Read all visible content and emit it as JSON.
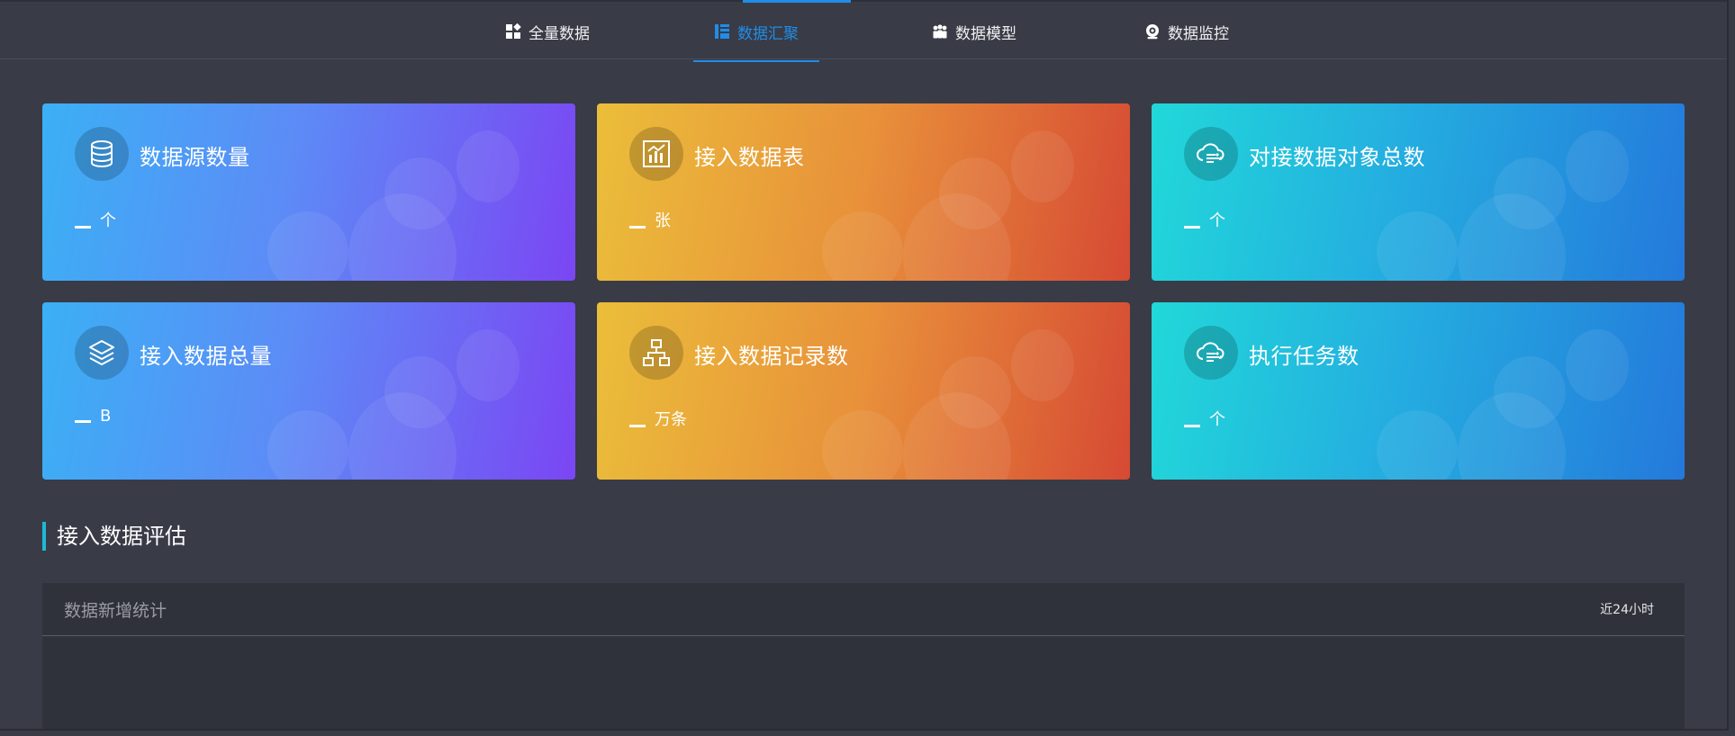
{
  "nav": {
    "items": [
      {
        "label": "全量数据",
        "icon": "grid-icon"
      },
      {
        "label": "数据汇聚",
        "icon": "layout-icon",
        "active": true
      },
      {
        "label": "数据模型",
        "icon": "people-icon"
      },
      {
        "label": "数据监控",
        "icon": "webcam-icon"
      }
    ]
  },
  "cards": [
    {
      "title": "数据源数量",
      "value": "_",
      "unit": "个",
      "icon": "database-icon",
      "theme": "blue-purple"
    },
    {
      "title": "接入数据表",
      "value": "_",
      "unit": "张",
      "icon": "chart-icon",
      "theme": "yellow-red"
    },
    {
      "title": "对接数据对象总数",
      "value": "_",
      "unit": "个",
      "icon": "cloud-flow-icon",
      "theme": "cyan-blue"
    },
    {
      "title": "接入数据总量",
      "value": "_",
      "unit": "B",
      "icon": "layers-icon",
      "theme": "blue-purple"
    },
    {
      "title": "接入数据记录数",
      "value": "_",
      "unit": "万条",
      "icon": "hierarchy-icon",
      "theme": "yellow-red"
    },
    {
      "title": "执行任务数",
      "value": "_",
      "unit": "个",
      "icon": "cloud-flow-icon",
      "theme": "cyan-blue"
    }
  ],
  "section": {
    "title": "接入数据评估"
  },
  "panel": {
    "title": "数据新增统计",
    "range": "近24小时"
  },
  "colors": {
    "background": "#393b47",
    "active_nav": "#1f8ee8",
    "section_accent": "#1fb8d6"
  }
}
